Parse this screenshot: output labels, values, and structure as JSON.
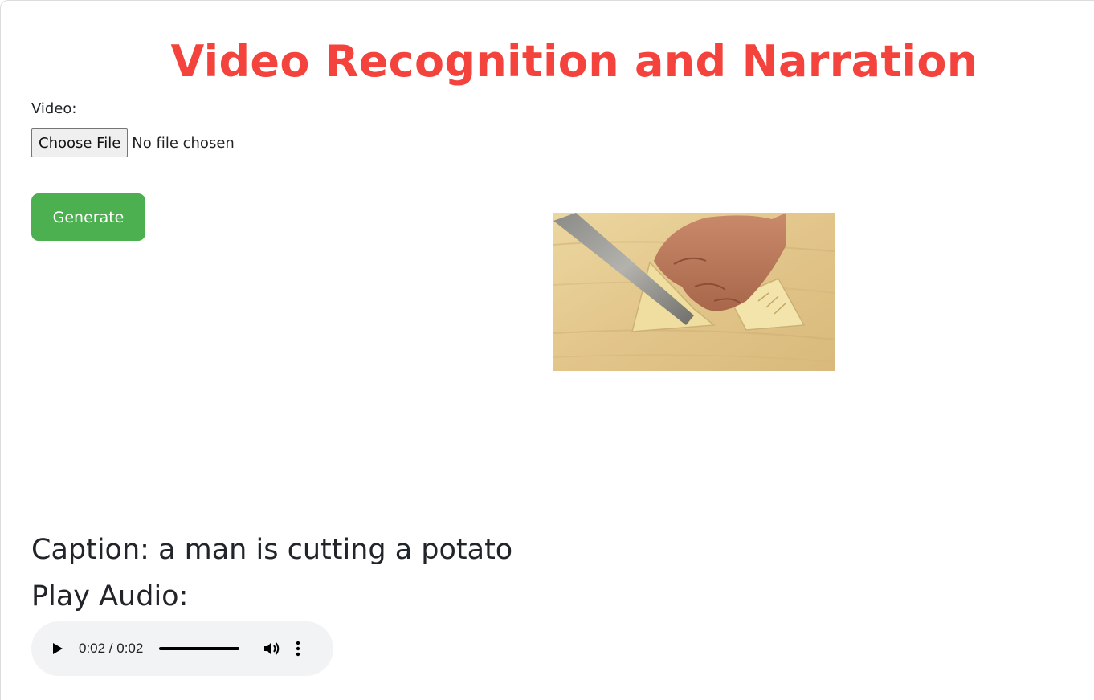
{
  "page": {
    "title": "Video Recognition and Narration"
  },
  "upload": {
    "video_label": "Video:",
    "choose_file_label": "Choose File",
    "file_status": "No file chosen"
  },
  "actions": {
    "generate_label": "Generate"
  },
  "result": {
    "caption": "Caption: a man is cutting a potato",
    "play_audio_heading": "Play Audio:"
  },
  "audio": {
    "current_time": "0:02",
    "duration": "0:02",
    "time_display": "0:02 / 0:02",
    "progress": 1.0,
    "play_icon": "play-icon",
    "volume_icon": "volume-icon",
    "more_icon": "more-vert-icon"
  },
  "colors": {
    "title": "#f4433c",
    "generate_button": "#4caf50",
    "audio_background": "#f1f3f4"
  }
}
